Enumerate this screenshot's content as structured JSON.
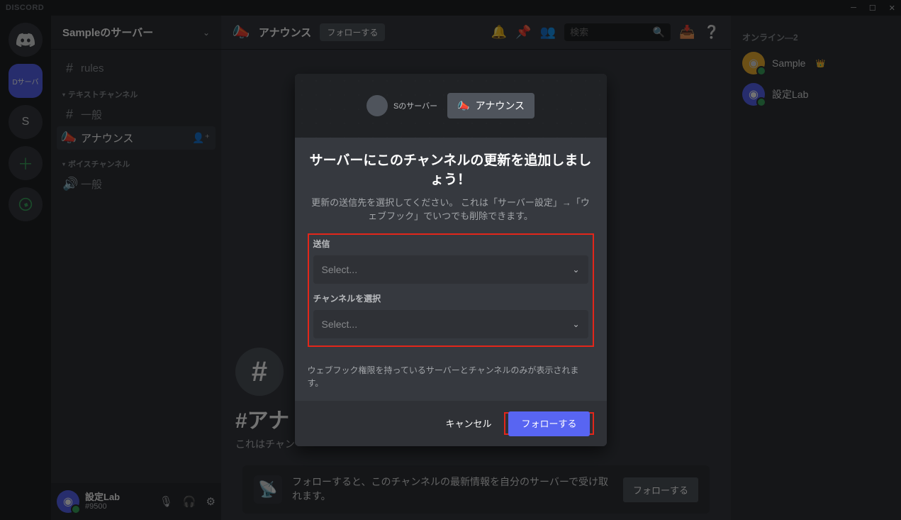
{
  "titlebar": {
    "brand": "DISCORD"
  },
  "rail": {
    "home_icon": "discord-icon",
    "selected_label": "Dサーバ",
    "letter": "S"
  },
  "server": {
    "name": "Sampleのサーバー",
    "rules_channel": "rules",
    "category_text": "テキストチャンネル",
    "general_channel": "一般",
    "announce_channel": "アナウンス",
    "category_voice": "ボイスチャンネル",
    "voice_general": "一般"
  },
  "user_panel": {
    "name": "設定Lab",
    "tag": "#9500"
  },
  "topbar": {
    "channel": "アナウンス",
    "follow_pill": "フォローする",
    "search_placeholder": "検索"
  },
  "welcome": {
    "title": "#アナ",
    "sub": "これはチャン"
  },
  "followbar": {
    "text": "フォローすると、このチャンネルの最新情報を自分のサーバーで受け取れます。",
    "button": "フォローする"
  },
  "members": {
    "group_label": "オンライン―2",
    "items": [
      {
        "name": "Sample",
        "avatar": "orange",
        "owner": true
      },
      {
        "name": "設定Lab",
        "avatar": "blurple",
        "owner": false
      }
    ]
  },
  "modal": {
    "server_small": "Sのサーバー",
    "channel_chip": "アナウンス",
    "title": "サーバーにこのチャンネルの更新を追加しましょう！",
    "subtitle": "更新の送信先を選択してください。 これは「サーバー設定」→「ウェブフック」でいつでも削除できます。",
    "field1_label": "送信",
    "field1_value": "Select...",
    "field2_label": "チャンネルを選択",
    "field2_value": "Select...",
    "hint": "ウェブフック権限を持っているサーバーとチャンネルのみが表示されます。",
    "cancel": "キャンセル",
    "confirm": "フォローする"
  }
}
